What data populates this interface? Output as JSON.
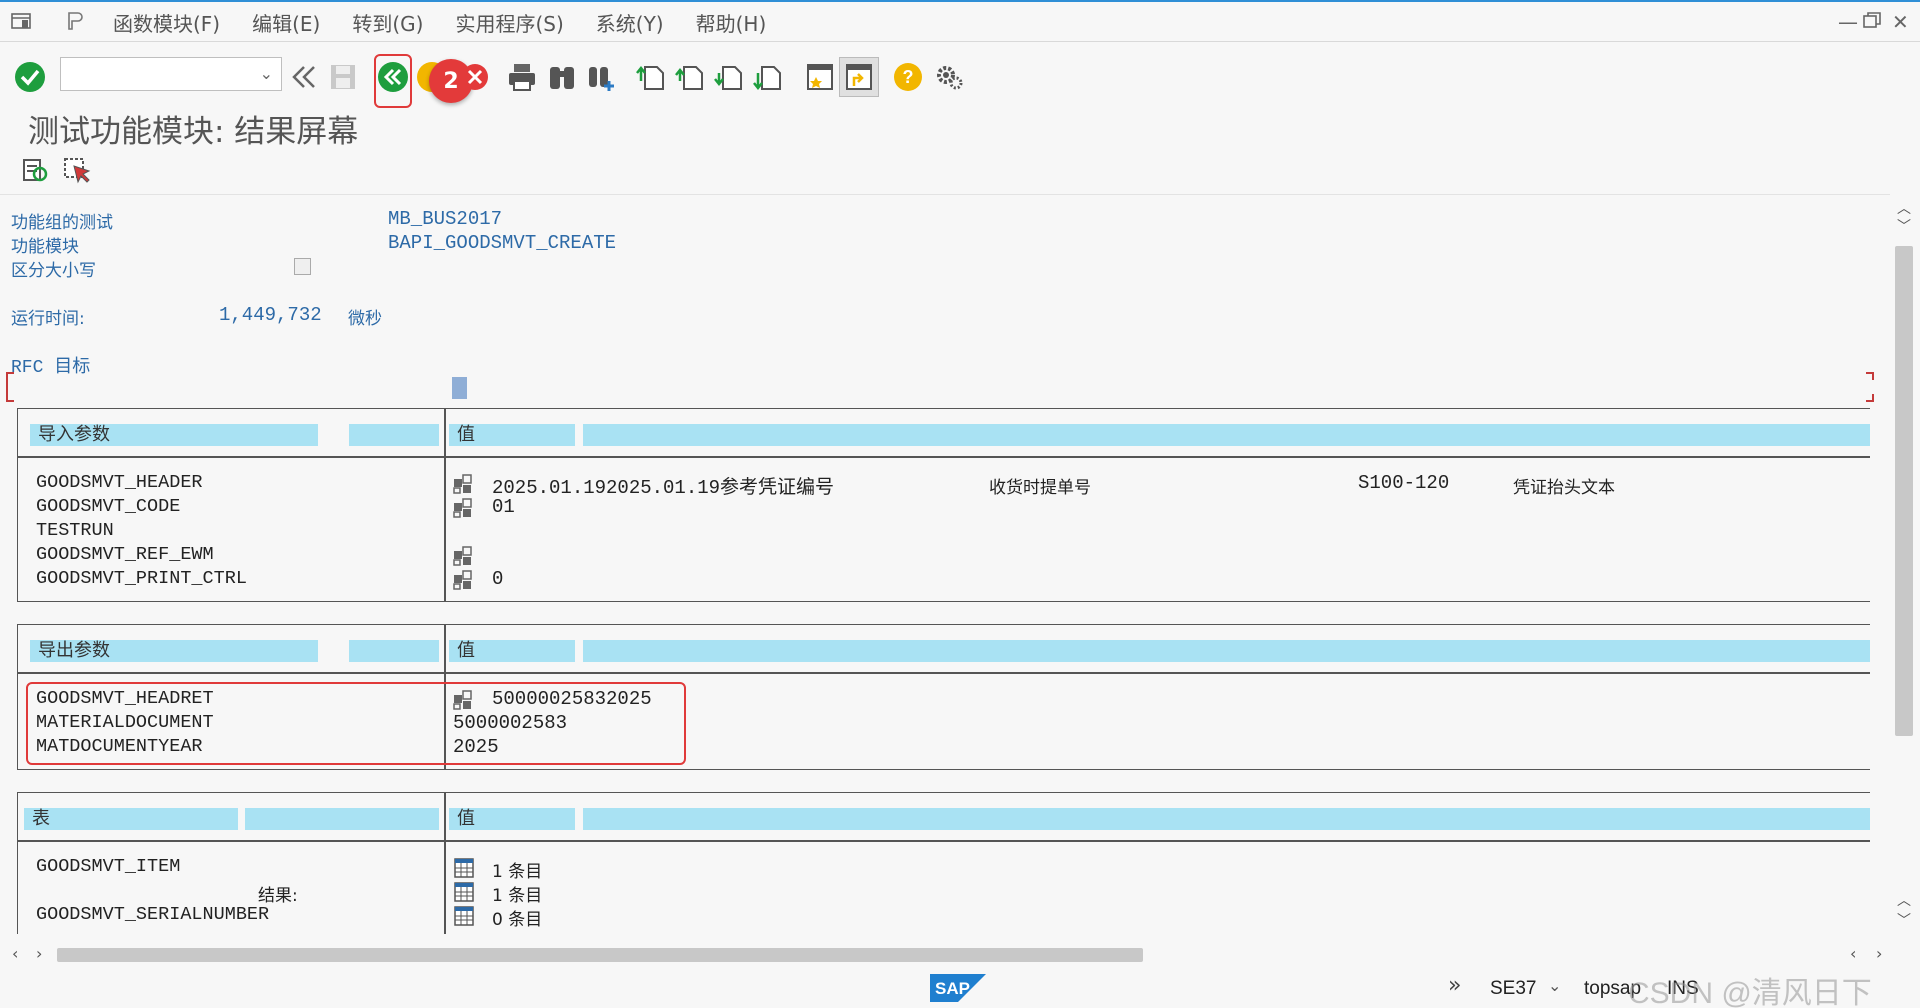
{
  "menu": {
    "items": [
      "函数模块(F)",
      "编辑(E)",
      "转到(G)",
      "实用程序(S)",
      "系统(Y)",
      "帮助(H)"
    ]
  },
  "toolbar": {
    "command_field": "",
    "badge_number": "2",
    "icons": [
      "enter-icon",
      "back-icon",
      "save-icon",
      "return-icon",
      "exit-icon",
      "cancel-icon",
      "print-icon",
      "find-icon",
      "find-next-icon",
      "first-page-icon",
      "previous-page-icon",
      "next-page-icon",
      "last-page-icon",
      "new-session-icon",
      "shortcut-icon",
      "help-icon",
      "settings-icon"
    ]
  },
  "page": {
    "title": "测试功能模块: 结果屏幕"
  },
  "info": {
    "group_label": "功能组的测试",
    "group_value": "MB_BUS2017",
    "module_label": "功能模块",
    "module_value": "BAPI_GOODSMVT_CREATE",
    "case_label": "区分大小写",
    "runtime_label": "运行时间:",
    "runtime_value": "1,449,732",
    "runtime_unit": "微秒",
    "rfc_label": "RFC 目标"
  },
  "import_section": {
    "header": "导入参数",
    "value_header": "值",
    "rows": [
      {
        "name": "GOODSMVT_HEADER",
        "value": "2025.01.192025.01.19参考凭证编号",
        "extra1": "收货时提单号",
        "extra2": "S100-120",
        "extra3": "凭证抬头文本"
      },
      {
        "name": "GOODSMVT_CODE",
        "value": "01"
      },
      {
        "name": "TESTRUN",
        "value": ""
      },
      {
        "name": "GOODSMVT_REF_EWM",
        "value": ""
      },
      {
        "name": "GOODSMVT_PRINT_CTRL",
        "value": "0"
      }
    ]
  },
  "export_section": {
    "header": "导出参数",
    "value_header": "值",
    "rows": [
      {
        "name": "GOODSMVT_HEADRET",
        "value": "50000025832025"
      },
      {
        "name": "MATERIALDOCUMENT",
        "value": "5000002583"
      },
      {
        "name": "MATDOCUMENTYEAR",
        "value": "2025"
      }
    ]
  },
  "tables_section": {
    "header": "表",
    "value_header": "值",
    "rows": [
      {
        "name": "GOODSMVT_ITEM",
        "value": "1 条目"
      },
      {
        "name": "结果:",
        "value": "1 条目"
      },
      {
        "name": "GOODSMVT_SERIALNUMBER",
        "value": "0 条目"
      }
    ]
  },
  "status": {
    "transaction": "SE37",
    "server": "topsap",
    "mode": "INS",
    "watermark": "CSDN @清风日下",
    "logo": "SAP"
  },
  "colors": {
    "header_cell": "#a9e2f3",
    "label_blue": "#2d6aa7",
    "highlight_red": "#e03a3a",
    "enter_green": "#1e9e3e",
    "help_yellow": "#f2b600"
  }
}
